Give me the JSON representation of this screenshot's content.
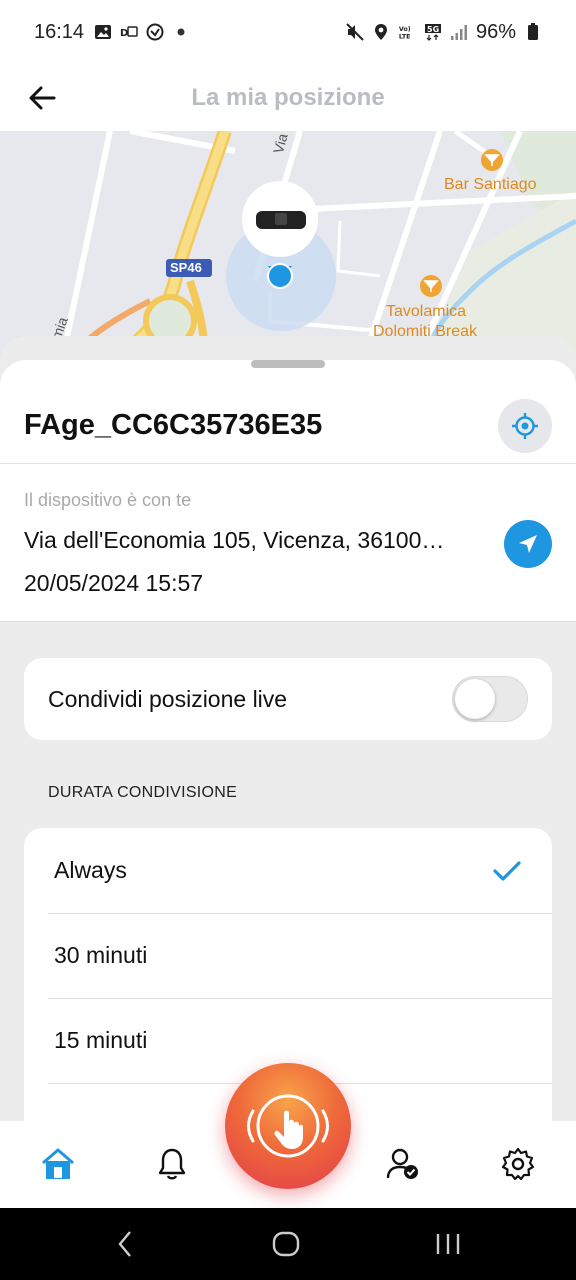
{
  "status_bar": {
    "time": "16:14",
    "battery": "96%",
    "icons_left": [
      "image-icon",
      "data-icon",
      "vpn-icon",
      "dot-icon"
    ],
    "icons_right": [
      "mute-icon",
      "location-icon",
      "volte-icon",
      "5g-icon",
      "signal-icon",
      "battery-icon"
    ]
  },
  "app_bar": {
    "title": "La mia posizione",
    "back_icon": "arrow-left-icon"
  },
  "map": {
    "labels": {
      "road_sp46": "SP46",
      "street_vertical": "Via dell'E",
      "bar": "Bar Santiago",
      "restaurant_1": "Tavolamica",
      "restaurant_2": "Dolomiti Break",
      "street_left": "mia"
    },
    "colors": {
      "background": "#e7e9ee",
      "highway": "#f6d66a",
      "pin": "#1e97e0",
      "poi": "#f0a533"
    }
  },
  "device": {
    "name": "FAge_CC6C35736E35",
    "locate_icon": "crosshair-icon"
  },
  "location": {
    "label": "Il dispositivo è con te",
    "address": "Via dell'Economia 105, Vicenza, 36100…",
    "datetime": "20/05/2024 15:57",
    "navigate_icon": "navigation-arrow-icon"
  },
  "live_share": {
    "label": "Condividi posizione live",
    "enabled": false
  },
  "duration": {
    "section_title": "DURATA CONDIVISIONE",
    "options": [
      {
        "label": "Always",
        "selected": true
      },
      {
        "label": "30 minuti",
        "selected": false
      },
      {
        "label": "15 minuti",
        "selected": false
      }
    ]
  },
  "bottom_nav": {
    "items": [
      "home-icon",
      "bell-icon",
      "sos-touch-icon",
      "user-check-icon",
      "gear-icon"
    ],
    "active": "home-icon"
  },
  "colors": {
    "accent": "#1e97e0",
    "sos_start": "#f8a44a",
    "sos_end": "#e23b4a",
    "sheet_bg": "#ececec"
  }
}
